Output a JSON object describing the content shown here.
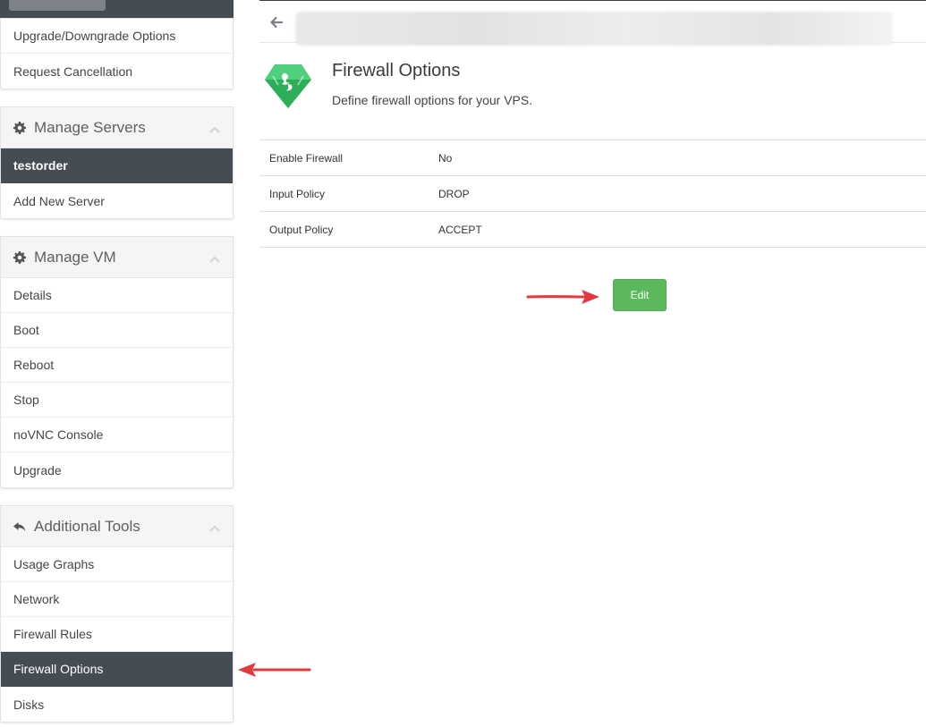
{
  "sidebar": {
    "account_panel": {
      "items": [
        {
          "label": "Upgrade/Downgrade Options"
        },
        {
          "label": "Request Cancellation"
        }
      ]
    },
    "servers_panel": {
      "title": "Manage Servers",
      "icon": "gear-icon",
      "items": [
        {
          "label": "testorder",
          "active": true
        },
        {
          "label": "Add New Server"
        }
      ]
    },
    "vm_panel": {
      "title": "Manage VM",
      "icon": "gear-icon",
      "items": [
        {
          "label": "Details"
        },
        {
          "label": "Boot"
        },
        {
          "label": "Reboot"
        },
        {
          "label": "Stop"
        },
        {
          "label": "noVNC Console"
        },
        {
          "label": "Upgrade"
        }
      ]
    },
    "tools_panel": {
      "title": "Additional Tools",
      "icon": "reply-icon",
      "items": [
        {
          "label": "Usage Graphs"
        },
        {
          "label": "Network"
        },
        {
          "label": "Firewall Rules"
        },
        {
          "label": "Firewall Options",
          "active": true
        },
        {
          "label": "Disks"
        }
      ]
    }
  },
  "header": {
    "back_icon": "arrow-left-icon"
  },
  "page": {
    "title": "Firewall Options",
    "subtitle": "Define firewall options for your VPS.",
    "logo_icon": "diamond-logo-icon"
  },
  "options": [
    {
      "label": "Enable Firewall",
      "value": "No"
    },
    {
      "label": "Input Policy",
      "value": "DROP"
    },
    {
      "label": "Output Policy",
      "value": "ACCEPT"
    }
  ],
  "actions": {
    "edit_label": "Edit"
  },
  "colors": {
    "sidebar_active": "#454c53",
    "button_green": "#5cb85c",
    "annotation_arrow": "#e03a3e",
    "logo_green": "#3cc46a"
  }
}
